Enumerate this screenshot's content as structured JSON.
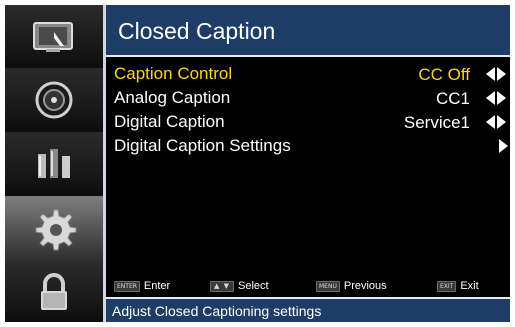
{
  "window": {
    "title": "Closed Caption"
  },
  "sidebar": {
    "items": [
      {
        "icon": "picture-icon"
      },
      {
        "icon": "audio-icon"
      },
      {
        "icon": "channel-icon"
      },
      {
        "icon": "settings-gear-icon",
        "active": true
      },
      {
        "icon": "lock-icon"
      }
    ]
  },
  "menu": {
    "items": [
      {
        "label": "Caption Control",
        "value": "CC Off",
        "control": "left-right",
        "selected": true
      },
      {
        "label": "Analog Caption",
        "value": "CC1",
        "control": "left-right"
      },
      {
        "label": "Digital Caption",
        "value": "Service1",
        "control": "left-right"
      },
      {
        "label": "Digital Caption Settings",
        "value": "",
        "control": "submenu"
      }
    ]
  },
  "hints": {
    "enter": {
      "key": "ENTER",
      "label": "Enter"
    },
    "select": {
      "key": "▲ ▼",
      "label": "Select"
    },
    "previous": {
      "key": "MENU",
      "label": "Previous"
    },
    "exit": {
      "key": "EXIT",
      "label": "Exit"
    }
  },
  "help": {
    "text": "Adjust Closed Captioning settings"
  },
  "colors": {
    "title_bar": "#1e3d66",
    "selected_text": "#ffd21f",
    "text": "#ffffff",
    "background": "#000000"
  }
}
